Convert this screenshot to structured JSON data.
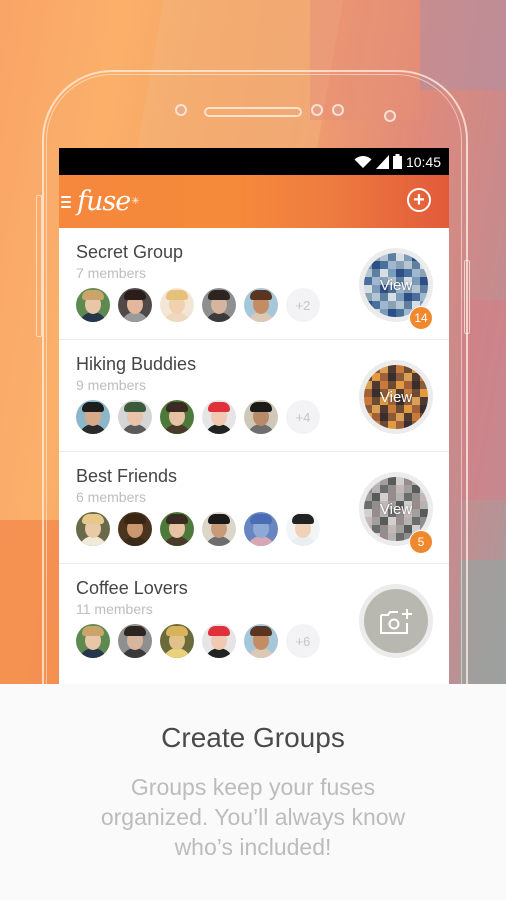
{
  "status_bar": {
    "time": "10:45",
    "icons": [
      "wifi-icon",
      "signal-icon",
      "battery-icon"
    ]
  },
  "app_bar": {
    "logo_text": "fuse",
    "menu_icon": "hamburger-menu-icon",
    "add_icon": "add-circle-icon"
  },
  "groups": [
    {
      "name": "Secret Group",
      "members_label": "7 members",
      "more_label": "+2",
      "thumb_label": "View",
      "badge": "14",
      "avatars": [
        {
          "skin": "#e9c6a8",
          "hair": "#c9a56a",
          "body": "#27364a",
          "bg": "#5e8a52"
        },
        {
          "skin": "#e3b79b",
          "hair": "#2a1e1a",
          "body": "#9a9a9a",
          "bg": "#4f4a48"
        },
        {
          "skin": "#f2d1b0",
          "hair": "#e6c17a",
          "body": "#eed9c0",
          "bg": "#f3e6d6"
        },
        {
          "skin": "#d7b49e",
          "hair": "#2c2522",
          "body": "#3a3a3a",
          "bg": "#8f8f8f"
        },
        {
          "skin": "#c58c64",
          "hair": "#5a3620",
          "body": "#dcc9b5",
          "bg": "#a6c6d9"
        }
      ],
      "thumb_colors": [
        "#9fb8d0",
        "#4a6f9a",
        "#2c4f86",
        "#7b9bb9",
        "#d7dde4",
        "#5e7f9f",
        "#b3c4d2",
        "#8aa1b6"
      ]
    },
    {
      "name": "Hiking Buddies",
      "members_label": "9 members",
      "more_label": "+4",
      "thumb_label": "View",
      "badge": "",
      "avatars": [
        {
          "skin": "#d7a98b",
          "hair": "#1d1d1d",
          "body": "#2a2a2a",
          "bg": "#8bb7c9"
        },
        {
          "skin": "#e6c3aa",
          "hair": "#3c5b3a",
          "body": "#5a5a5a",
          "bg": "#d5d5d5"
        },
        {
          "skin": "#e8c3a3",
          "hair": "#3a2a22",
          "body": "#4a3a2a",
          "bg": "#4d7a3a"
        },
        {
          "skin": "#f1c9b3",
          "hair": "#e0303b",
          "body": "#222222",
          "bg": "#e5e5e5"
        },
        {
          "skin": "#b98a68",
          "hair": "#1a1a1a",
          "body": "#6e6e6e",
          "bg": "#cfc8b8"
        }
      ],
      "thumb_colors": [
        "#3b2d2a",
        "#a0613a",
        "#e39a3f",
        "#6d4a33",
        "#c87a3a",
        "#4e3a30",
        "#d9a055",
        "#8a5a3a"
      ]
    },
    {
      "name": "Best Friends",
      "members_label": "6 members",
      "more_label": "",
      "thumb_label": "View",
      "badge": "5",
      "avatars": [
        {
          "skin": "#e9c9a6",
          "hair": "#e6c98a",
          "body": "#f2ead8",
          "bg": "#6a6a4a"
        },
        {
          "skin": "#c9986e",
          "hair": "#3a2414",
          "body": "#3a2a1a",
          "bg": "#4a3420"
        },
        {
          "skin": "#e8c3a3",
          "hair": "#3a2a22",
          "body": "#4a3a2a",
          "bg": "#4d7a3a"
        },
        {
          "skin": "#c89a78",
          "hair": "#1a1a1a",
          "body": "#6e6e6e",
          "bg": "#dcd6c8"
        },
        {
          "skin": "#8fa9d6",
          "hair": "#4a6cb3",
          "body": "#d6a7b6",
          "bg": "#6a86c0"
        },
        {
          "skin": "#f0d2b8",
          "hair": "#222222",
          "body": "#e9eef2",
          "bg": "#f2f4f5"
        }
      ],
      "thumb_colors": [
        "#8f8f8f",
        "#6c6c6c",
        "#b4b4b4",
        "#9a8a8a",
        "#d0d0d0",
        "#5a5a5a",
        "#a0a0a0",
        "#c4b8b8"
      ]
    },
    {
      "name": "Coffee Lovers",
      "members_label": "11 members",
      "more_label": "+6",
      "thumb_label": "",
      "badge": "",
      "camera_icon": "add-photo-camera-icon",
      "avatars": [
        {
          "skin": "#e9c6a8",
          "hair": "#c9a56a",
          "body": "#27364a",
          "bg": "#5e8a52"
        },
        {
          "skin": "#d7b49e",
          "hair": "#2c2522",
          "body": "#3a3a3a",
          "bg": "#8f8f8f"
        },
        {
          "skin": "#e2c08a",
          "hair": "#d9b35a",
          "body": "#e8d27a",
          "bg": "#6a6a3a"
        },
        {
          "skin": "#f1c9b3",
          "hair": "#e0303b",
          "body": "#222222",
          "bg": "#e5e5e5"
        },
        {
          "skin": "#c58c64",
          "hair": "#5a3620",
          "body": "#dcc9b5",
          "bg": "#a6c6d9"
        }
      ]
    }
  ],
  "caption": {
    "title": "Create Groups",
    "body": "Groups keep your fuses organized. You’ll always know who’s included!"
  },
  "colors": {
    "accent": "#f58a3a",
    "badge": "#f0892d",
    "title_text": "#454545",
    "muted_text": "#bdbdbd"
  }
}
